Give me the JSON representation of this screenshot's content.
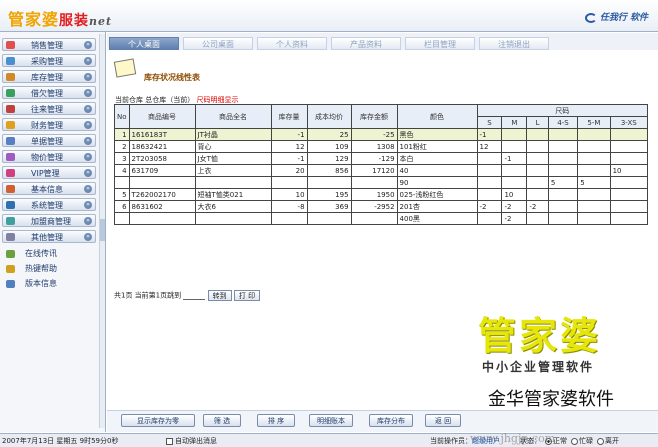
{
  "header": {
    "logo": {
      "part1": "管家婆",
      "part2": "服装",
      "part3": "net"
    },
    "brand": "任我行 软件"
  },
  "sidebar": {
    "items": [
      {
        "label": "销售管理",
        "icon": "sales-icon",
        "color": "#e05050"
      },
      {
        "label": "采购管理",
        "icon": "purchase-icon",
        "color": "#4a8fd0"
      },
      {
        "label": "库存管理",
        "icon": "inventory-icon",
        "color": "#d08a2a"
      },
      {
        "label": "借欠管理",
        "icon": "loan-icon",
        "color": "#3aa060"
      },
      {
        "label": "往来管理",
        "icon": "contacts-icon",
        "color": "#c04040"
      },
      {
        "label": "财务管理",
        "icon": "finance-icon",
        "color": "#e0a020"
      },
      {
        "label": "单据管理",
        "icon": "documents-icon",
        "color": "#5a7fc0"
      },
      {
        "label": "物价管理",
        "icon": "price-icon",
        "color": "#a05ac0"
      },
      {
        "label": "VIP管理",
        "icon": "vip-icon",
        "color": "#d04080"
      },
      {
        "label": "基本信息",
        "icon": "info-icon",
        "color": "#d06030"
      },
      {
        "label": "系统管理",
        "icon": "system-icon",
        "color": "#3070b0"
      },
      {
        "label": "加盟商管理",
        "icon": "franchise-icon",
        "color": "#40a0a0"
      },
      {
        "label": "其他管理",
        "icon": "other-icon",
        "color": "#8080a0"
      }
    ],
    "extras": [
      {
        "label": "在线传讯",
        "icon": "speaker-icon",
        "color": "#6aa040"
      },
      {
        "label": "热键帮助",
        "icon": "hotkey-icon",
        "color": "#d0a020"
      },
      {
        "label": "版本信息",
        "icon": "version-icon",
        "color": "#5080c0"
      }
    ]
  },
  "tabs": [
    "个人桌面",
    "公司桌面",
    "个人资料",
    "产品资料",
    "栏目管理",
    "注销退出"
  ],
  "report": {
    "title": "库存状况线性表",
    "filter_prefix": "当前仓库 总仓库（当前）",
    "filter_red": "尺码明细显示"
  },
  "table": {
    "headers": [
      "No",
      "商品编号",
      "商品全名",
      "库存量",
      "成本均价",
      "库存金额",
      "颜色",
      "尺码"
    ],
    "sizes": [
      "S",
      "M",
      "L",
      "4-S",
      "5-M",
      "3-XS"
    ],
    "rows": [
      {
        "no": "1",
        "code": "1616183T",
        "name": "JT衬晶",
        "qty": "-1",
        "cost": "25",
        "amount": "-25",
        "color": "黑色",
        "s": [
          "-1",
          "",
          "",
          "",
          "",
          ""
        ]
      },
      {
        "no": "2",
        "code": "18632421",
        "name": "背心",
        "qty": "12",
        "cost": "109",
        "amount": "1308",
        "color": "101粉红",
        "s": [
          "12",
          "",
          "",
          "",
          "",
          ""
        ]
      },
      {
        "no": "3",
        "code": "2T203058",
        "name": "J女T恤",
        "qty": "-1",
        "cost": "129",
        "amount": "-129",
        "color": "本白",
        "s": [
          "",
          "-1",
          "",
          "",
          "",
          ""
        ]
      },
      {
        "no": "4",
        "code": "631709",
        "name": "上衣",
        "qty": "20",
        "cost": "856",
        "amount": "17120",
        "color": "40",
        "s": [
          "",
          "",
          "",
          "",
          "",
          "10"
        ]
      },
      {
        "no": "",
        "code": "",
        "name": "",
        "qty": "",
        "cost": "",
        "amount": "",
        "color": "90",
        "s": [
          "",
          "",
          "",
          "5",
          "5",
          ""
        ]
      },
      {
        "no": "5",
        "code": "T262002170",
        "name": "短袖T恤类021",
        "qty": "10",
        "cost": "195",
        "amount": "1950",
        "color": "025-浅粉红色",
        "s": [
          "",
          "10",
          "",
          "",
          "",
          ""
        ]
      },
      {
        "no": "6",
        "code": "8631602",
        "name": "大衣6",
        "qty": "-8",
        "cost": "369",
        "amount": "-2952",
        "color": "201杏",
        "s": [
          "-2",
          "-2",
          "-2",
          "",
          "",
          ""
        ]
      },
      {
        "no": "",
        "code": "",
        "name": "",
        "qty": "",
        "cost": "",
        "amount": "",
        "color": "400黑",
        "s": [
          "",
          "-2",
          "",
          "",
          "",
          ""
        ]
      }
    ]
  },
  "pager": {
    "text": "共1页 当前第1页跳到",
    "jump": "转到",
    "print": "打 印"
  },
  "watermark": {
    "big": "管家婆",
    "sub": "中小企业管理软件",
    "company": "金华管家婆软件",
    "url": "www.jhgjp.com"
  },
  "buttons": [
    "显示库存为零",
    "筛 选",
    "排 序",
    "明细账本",
    "库存分布",
    "返 回"
  ],
  "status": {
    "datetime": "2007年7月13日 星期五 9时59分0秒",
    "auto_popup": "自动弹出消息",
    "operator_label": "当前操作员：",
    "operator": "超级用户",
    "state_label": "状态：",
    "states": [
      "正常",
      "忙碌",
      "离开"
    ]
  }
}
